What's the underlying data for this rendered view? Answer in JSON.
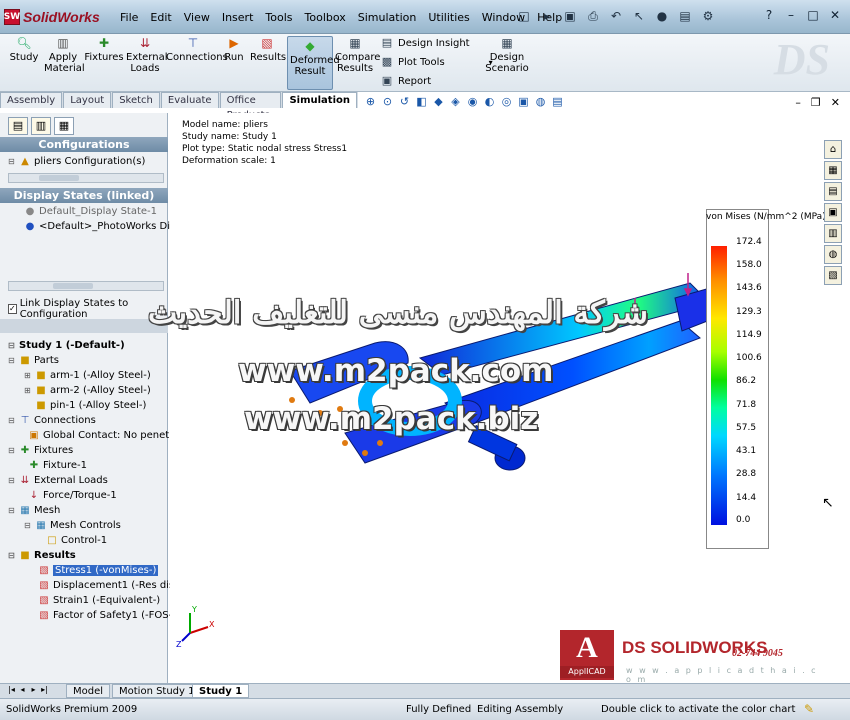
{
  "app": {
    "name": "SolidWorks",
    "logo_mark": "SW"
  },
  "menu": [
    "File",
    "Edit",
    "View",
    "Insert",
    "Tools",
    "Toolbox",
    "Simulation",
    "Utilities",
    "Window",
    "Help"
  ],
  "quick_tools_icons": [
    "new-icon",
    "open-icon",
    "save-icon",
    "print-icon",
    "undo-icon",
    "select-icon",
    "rebuild-icon",
    "file-props-icon",
    "options-icon"
  ],
  "quick_tools_glyphs": [
    "□",
    "▸",
    "▣",
    "⎙",
    "↶",
    "↖",
    "●",
    "▤",
    "⚙"
  ],
  "window_controls": [
    "?",
    "–",
    "□",
    "✕"
  ],
  "command_manager": {
    "study": "Study",
    "apply_material": "Apply Material",
    "fixtures": "Fixtures",
    "external_loads": "External Loads",
    "connections": "Connections",
    "run": "Run",
    "results": "Results",
    "deformed_result": "Deformed Result",
    "compare_results": "Compare Results",
    "design_insight": "Design Insight",
    "plot_tools": "Plot Tools",
    "report": "Report",
    "design_scenario": "Design Scenario"
  },
  "tabs": [
    "Assembly",
    "Layout",
    "Sketch",
    "Evaluate",
    "Office Products",
    "Simulation"
  ],
  "active_tab": "Simulation",
  "left_panel": {
    "configurations_header": "Configurations",
    "config_item": "pliers Configuration(s)",
    "display_states_header": "Display States (linked)",
    "display_state_1": "Default_Display State-1",
    "display_state_2": "<Default>_PhotoWorks Displ",
    "link_display_states": "Link Display States to Configuration",
    "tree": {
      "study": "Study 1 (-Default-)",
      "parts": "Parts",
      "arm1": "arm-1 (-Alloy Steel-)",
      "arm2": "arm-2 (-Alloy Steel-)",
      "pin1": "pin-1 (-Alloy Steel-)",
      "connections": "Connections",
      "global_contact": "Global Contact: No penet",
      "fixtures": "Fixtures",
      "fixture1": "Fixture-1",
      "external_loads": "External Loads",
      "force_torque": "Force/Torque-1",
      "mesh": "Mesh",
      "mesh_controls": "Mesh Controls",
      "control1": "Control-1",
      "results": "Results",
      "stress1": "Stress1 (-vonMises-)",
      "displacement1": "Displacement1 (-Res disp-",
      "strain1": "Strain1 (-Equivalent-)",
      "fos1": "Factor of Safety1 (-FOS-)"
    }
  },
  "plot_info": {
    "model_name": "Model name: pliers",
    "study_name": "Study name: Study 1",
    "plot_type": "Plot type: Static nodal stress Stress1",
    "deformation_scale": "Deformation scale: 1"
  },
  "legend": {
    "title": "von Mises (N/mm^2 (MPa))",
    "values": [
      "172.4",
      "158.0",
      "143.6",
      "129.3",
      "114.9",
      "100.6",
      "86.2",
      "71.8",
      "57.5",
      "43.1",
      "28.8",
      "14.4",
      "0.0"
    ],
    "colors": {
      "max": "#ff1f00",
      "min": "#0010e0"
    }
  },
  "watermarks": {
    "arabic": "شركة المهندس منسى للتغليف الحديث",
    "url1": "www.m2pack.com",
    "url2": "www.m2pack.biz"
  },
  "bottom_tabs": [
    "Model",
    "Motion Study 1",
    "Study 1"
  ],
  "nav_arrows": [
    "|◂",
    "◂",
    "▸",
    "▸|"
  ],
  "status": {
    "product": "SolidWorks Premium 2009",
    "defined": "Fully Defined",
    "editing": "Editing Assembly",
    "hint": "Double click to activate the color chart"
  },
  "branding": {
    "applicad": "ApplICAD",
    "ds_solidworks": "DS SOLIDWORKS",
    "phone": "02-744 9045",
    "url": "w w w . a p p l i c a d t h a i . c o m"
  },
  "triad_axes": [
    "X",
    "Y",
    "Z"
  ]
}
